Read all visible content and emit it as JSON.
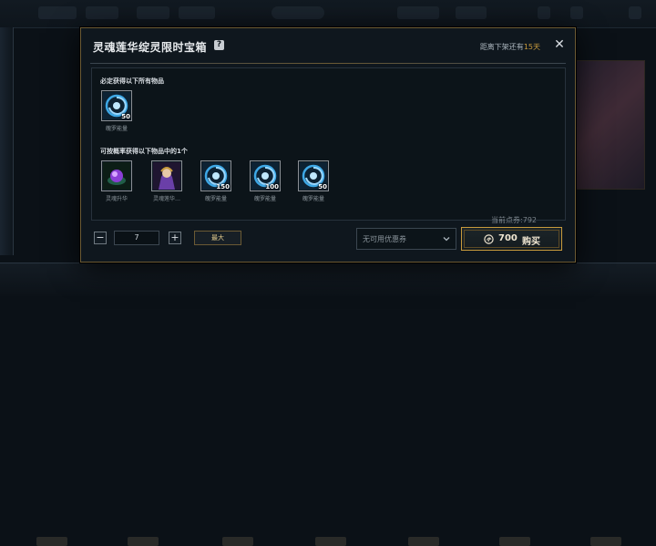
{
  "dialog": {
    "title": "灵魂莲华绽灵限时宝箱",
    "help_icon": "?",
    "countdown_prefix": "距离下架还有",
    "countdown_days": "15天",
    "close_icon": "✕"
  },
  "guaranteed": {
    "label": "必定获得以下所有物品",
    "items": [
      {
        "name": "魄罗能量",
        "count": "50",
        "icon": "blue-swirl-icon"
      }
    ]
  },
  "chance": {
    "label": "可按概率获得以下物品中的1个",
    "items": [
      {
        "name": "灵魂升华",
        "count": "",
        "icon": "purple-orb-icon"
      },
      {
        "name": "灵魂莲华…",
        "count": "",
        "icon": "champion-portrait-icon"
      },
      {
        "name": "魄罗能量",
        "count": "150",
        "icon": "blue-swirl-icon"
      },
      {
        "name": "魄罗能量",
        "count": "100",
        "icon": "blue-swirl-icon"
      },
      {
        "name": "魄罗能量",
        "count": "50",
        "icon": "blue-swirl-icon"
      }
    ]
  },
  "quantity": {
    "minus": "−",
    "value": "7",
    "plus": "+",
    "max_label": "最大"
  },
  "balance": "当前点券:792",
  "coupon": {
    "placeholder": "无可用优惠券",
    "chevron_icon": "chevron-down-icon"
  },
  "buy": {
    "price": "700",
    "label": "购买",
    "currency_icon": "riot-points-icon"
  },
  "colors": {
    "accent_gold": "#c89b3c",
    "panel_bg": "#0f171e",
    "swirl_blue": "#3ea8e6"
  }
}
